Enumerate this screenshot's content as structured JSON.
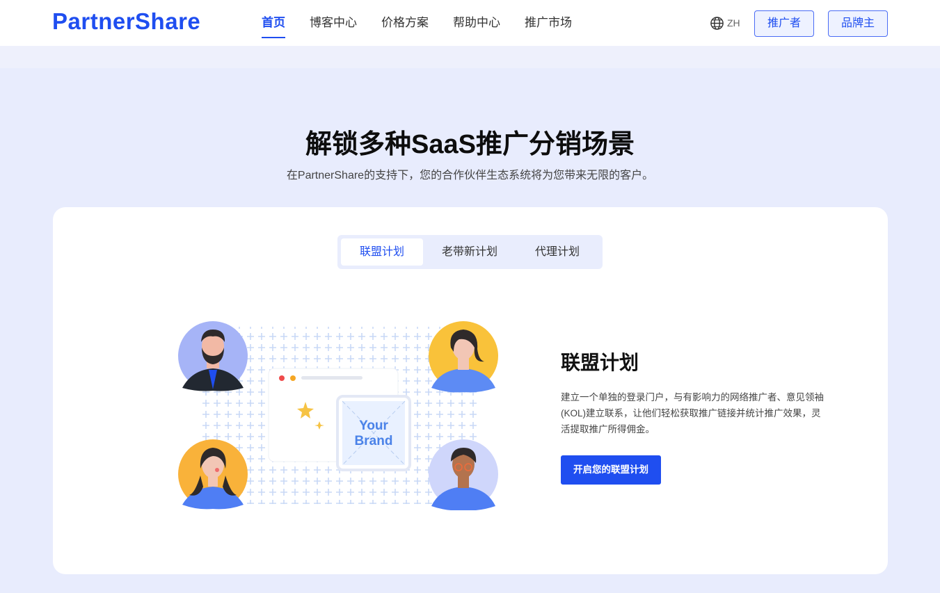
{
  "brand": {
    "logo_text": "PartnerShare",
    "accent": "#1f4ef0"
  },
  "nav": {
    "items": [
      {
        "label": "首页",
        "active": true
      },
      {
        "label": "博客中心",
        "active": false
      },
      {
        "label": "价格方案",
        "active": false
      },
      {
        "label": "帮助中心",
        "active": false
      },
      {
        "label": "推广市场",
        "active": false
      }
    ],
    "language": {
      "icon": "globe-icon",
      "label": "ZH"
    },
    "promoter_button": "推广者",
    "brand_button": "品牌主"
  },
  "hero": {
    "title": "解锁多种SaaS推广分销场景",
    "subtitle": "在PartnerShare的支持下，您的合作伙伴生态系统将为您带来无限的客户。"
  },
  "tabs": [
    {
      "label": "联盟计划",
      "active": true
    },
    {
      "label": "老带新计划",
      "active": false
    },
    {
      "label": "代理计划",
      "active": false
    }
  ],
  "illustration": {
    "brand_text_line1": "Your",
    "brand_text_line2": "Brand"
  },
  "feature": {
    "title": "联盟计划",
    "description": "建立一个单独的登录门户，与有影响力的网络推广者、意见领袖(KOL)建立联系，让他们轻松获取推广链接并统计推广效果，灵活提取推广所得佣金。",
    "cta": "开启您的联盟计划"
  }
}
